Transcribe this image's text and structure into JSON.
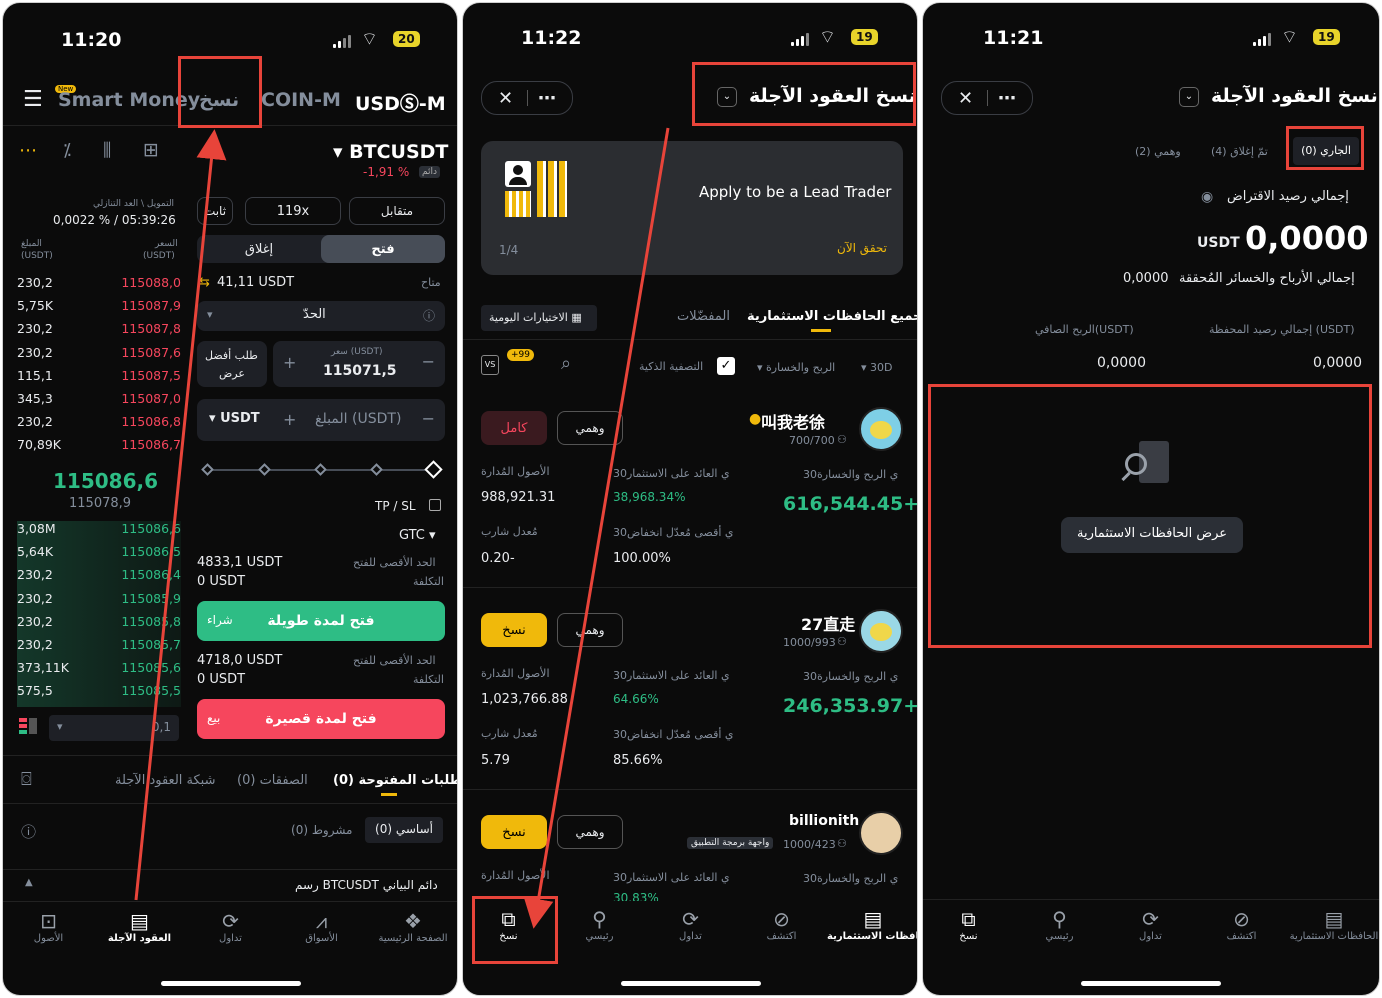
{
  "p1": {
    "time": "11:20",
    "battery": "20",
    "header": {
      "menu_icon": "menu-icon",
      "new_badge": "New",
      "smart_money": "Smart Money",
      "copy_tab": "نسخ",
      "coinm": "COIN-M",
      "usdm": "USDⓈ-M"
    },
    "symbol": "BTCUSDT",
    "perp": "دائم",
    "change": "-1,91 %",
    "funding_label": "التمويل \\ العد التنازلي",
    "funding_value": "0,0022 % / 05:39:26",
    "col_price": "السعر",
    "col_price_unit": "(USDT)",
    "col_amount": "المبلغ",
    "col_amount_unit": "(USDT)",
    "asks": [
      [
        "230,2",
        "115088,0"
      ],
      [
        "5,75K",
        "115087,9"
      ],
      [
        "230,2",
        "115087,8"
      ],
      [
        "230,2",
        "115087,6"
      ],
      [
        "115,1",
        "115087,5"
      ],
      [
        "345,3",
        "115087,0"
      ],
      [
        "230,2",
        "115086,8"
      ],
      [
        "70,89K",
        "115086,7"
      ]
    ],
    "mid_price": "115086,6",
    "mark_price": "115078,9",
    "bids": [
      [
        "3,08M",
        "115086,6"
      ],
      [
        "5,64K",
        "115086,5"
      ],
      [
        "230,2",
        "115086,4"
      ],
      [
        "230,2",
        "115085,9"
      ],
      [
        "230,2",
        "115085,8"
      ],
      [
        "230,2",
        "115085,7"
      ],
      [
        "373,11K",
        "115085,6"
      ],
      [
        "575,5",
        "115085,5"
      ]
    ],
    "depth_value": "0,1",
    "mode_cross": "متقابل",
    "leverage": "119x",
    "mode_fixed": "ثابت",
    "open_tab": "فتح",
    "close_tab": "إغلاق",
    "available_label": "متاح",
    "available_value": "41,11 USDT",
    "order_type": "الحدّ",
    "price_label": "سعر (USDT)",
    "price_value": "115071,5",
    "best_bid_1": "طلب أفضل",
    "best_bid_2": "عرض",
    "amount_placeholder": "المبلغ (USDT)",
    "amount_unit": "USDT",
    "tpsl": "TP / SL",
    "gtc": "GTC",
    "max_open_label": "الحد الأقصى للفتح",
    "max_long": "4833,1 USDT",
    "cost_label": "التكلفة",
    "cost_long": "0 USDT",
    "long_buy": "شراء",
    "long_btn": "فتح لمدة طويلة",
    "max_short": "4718,0 USDT",
    "cost_short": "0 USDT",
    "short_sell": "بيع",
    "short_btn": "فتح لمدة قصيرة",
    "tabs": [
      "الطلبات المفتوحة (0)",
      "الصفقات (0)",
      "شبكة العقود الآجلة"
    ],
    "filter_basic": "أساسي (0)",
    "filter_cond": "مشروط (0)",
    "chart_bar": "رسم BTCUSDT دائم البياني",
    "nav": [
      "الصفحة الرئيسية",
      "الأسواق",
      "تداول",
      "العقود الآجلة",
      "الأصول"
    ]
  },
  "p2": {
    "time": "11:22",
    "battery": "19",
    "title": "نسخ العقود الآجلة",
    "banner_title": "Apply to be a Lead Trader",
    "banner_link": "تحقق الآن",
    "banner_page": "1/4",
    "tabs": [
      "جميع الحافظات الاستثمارية",
      "المفضّلات"
    ],
    "daily_picks": "الاختيارات اليومية",
    "filter_period": "30D",
    "filter_pnl": "الربح والخسارة",
    "filter_smart": "التصفية الذكية",
    "badge": "+99",
    "traders": [
      {
        "name": "叫我老徐",
        "followers": "700/700",
        "btn1": "كامل",
        "btn2": "وهمي",
        "pnl_label": "30ي الربح والخسارة",
        "pnl": "616,544.45+",
        "roi_label": "30ي العائد على الاستثمار",
        "roi": "38,968.34%",
        "aum_label": "الأصول المُدارة",
        "aum": "988,921.31",
        "mdd_label": "30ي أقصى مُعدّل انخفاض",
        "mdd": "100.00%",
        "sharpe_label": "مُعدل شارب",
        "sharpe": "0.20-"
      },
      {
        "name": "27直走",
        "followers": "1000/993",
        "btn1": "نسخ",
        "btn2": "وهمي",
        "pnl_label": "30ي الربح والخسارة",
        "pnl": "246,353.97+",
        "roi_label": "30ي العائد على الاستثمار",
        "roi": "64.66%",
        "aum_label": "الأصول المُدارة",
        "aum": "1,023,766.88",
        "mdd_label": "30ي أقصى مُعدّل انخفاض",
        "mdd": "85.66%",
        "sharpe_label": "مُعدل شارب",
        "sharpe": "5.79"
      },
      {
        "name": "billionith",
        "followers": "1000/423",
        "api": "واجهة برمجة التطبيق",
        "btn1": "نسخ",
        "btn2": "وهمي",
        "pnl_label": "30ي الربح والخسارة",
        "roi_label": "30ي العائد على الاستثمار",
        "roi": "30.83%",
        "aum_label": "الأصول المُدارة"
      }
    ],
    "nav": [
      "الحافظات الاستثمارية",
      "اكتشف",
      "تداول",
      "رئيسي",
      "نسخ"
    ]
  },
  "p3": {
    "time": "11:21",
    "battery": "19",
    "title": "نسخ العقود الآجلة",
    "tabs": [
      "الجاري (0)",
      "تمّ إغلاق (4)",
      "وهمي (2)"
    ],
    "balance_label": "إجمالي رصيد الاقتراض",
    "balance": "0,0000",
    "balance_unit": "USDT",
    "realized_label": "إجمالي الأرباح والخسائر المُحققة",
    "realized": "0,0000",
    "wallet_label": "إجمالي رصيد المحفظة (USDT)",
    "wallet": "0,0000",
    "net_label": "الربح الصافي(USDT)",
    "net": "0,0000",
    "view_btn": "عرض الحافظات الاستثمارية",
    "nav": [
      "الحافظات الاستثمارية",
      "اكتشف",
      "تداول",
      "رئيسي",
      "نسخ"
    ]
  },
  "colors": {
    "green": "#2ebd85",
    "red": "#f6465d",
    "yellow": "#f0b90b",
    "annotation": "#e8443a"
  }
}
